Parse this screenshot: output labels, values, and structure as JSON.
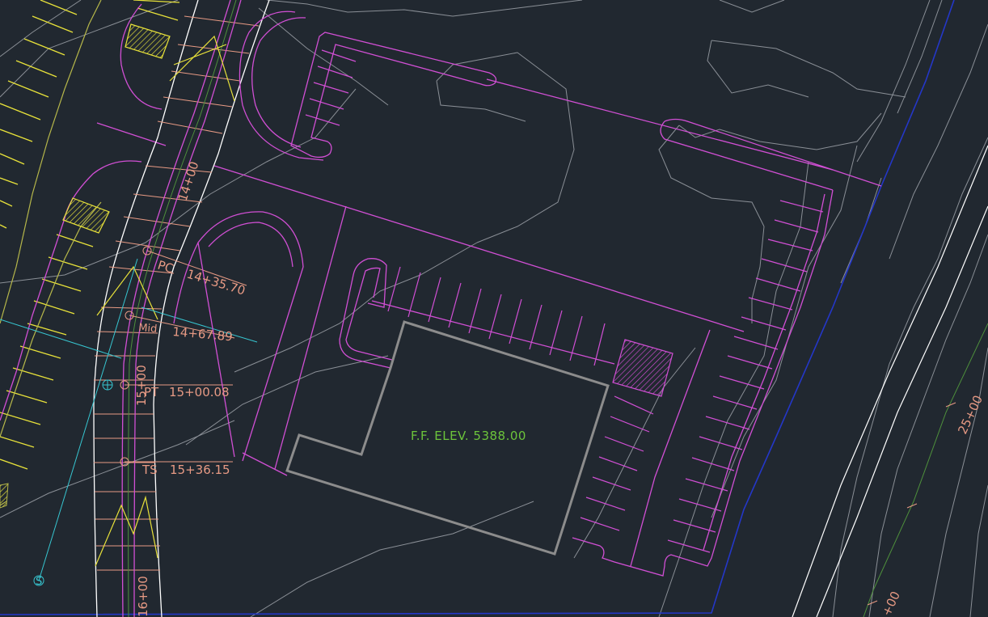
{
  "drawing": {
    "background": "#212830",
    "colors": {
      "contour": "#8a8f96",
      "parking": "#d14fd4",
      "road": "#ffffff",
      "yellow": "#e8e23a",
      "annotation": "#e79a84",
      "centerline": "#4e8f3c",
      "alignment": "#37c6d1",
      "boundary": "#2437c8",
      "building": "#8c8c8c",
      "elev_text": "#6cc43b"
    },
    "building": {
      "ff_elev": "F.F. ELEV. 5388.00"
    },
    "stations": {
      "s14": "14+00",
      "s15": "15+00",
      "s16": "16+00",
      "s25": "25+00",
      "s24": "+00"
    },
    "curve_points": [
      {
        "label": "PC",
        "station": "14+35.70"
      },
      {
        "label": "Mid",
        "station": "14+67.89"
      },
      {
        "label": "PT",
        "station": "15+00.08"
      },
      {
        "label": "TS",
        "station": "15+36.15"
      }
    ],
    "sewer_symbol": "S"
  }
}
